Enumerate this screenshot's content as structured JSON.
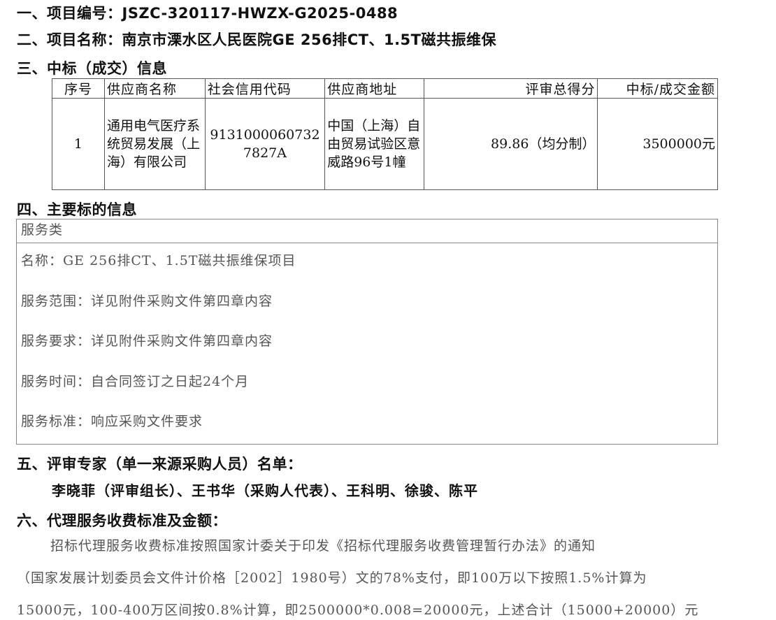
{
  "headings": {
    "h1": "一、项目编号：JSZC-320117-HWZX-G2025-0488",
    "h2": "二、项目名称：南京市溧水区人民医院GE 256排CT、1.5T磁共振维保",
    "h3": "三、中标（成交）信息",
    "h4": "四、主要标的信息",
    "h5": "五、评审专家（单一来源采购人员）名单：",
    "h6": "六、代理服务收费标准及金额："
  },
  "award_table": {
    "headers": [
      "序号",
      "供应商名称",
      "社会信用代码",
      "供应商地址",
      "评审总得分",
      "中标/成交金额"
    ],
    "rows": [
      {
        "no": "1",
        "supplier": "通用电气医疗系统贸易发展（上海）有限公司",
        "credit_code": "91310000607327827A",
        "address": "中国（上海）自由贸易试验区意威路96号1幢",
        "score": "89.86（均分制）",
        "amount": "3500000元"
      }
    ]
  },
  "service": {
    "category": "服务类",
    "lines": [
      "名称：GE 256排CT、1.5T磁共振维保项目",
      "服务范围：详见附件采购文件第四章内容",
      "服务要求：详见附件采购文件第四章内容",
      "服务时间：自合同签订之日起24个月",
      "服务标准：响应采购文件要求"
    ]
  },
  "experts": "李晓菲（评审组长）、王书华（采购人代表）、王科明、徐骏、陈平",
  "fee_text": [
    "招标代理服务收费标准按照国家计委关于印发《招标代理服务收费管理暂行办法》的通知",
    "（国家发展计划委员会文件计价格［2002］1980号）文的78%支付，即100万以下按照1.5%计算为",
    "15000元，100-400万区间按0.8%计算，即2500000*0.008=20000元，上述合计（15000+20000）元"
  ]
}
